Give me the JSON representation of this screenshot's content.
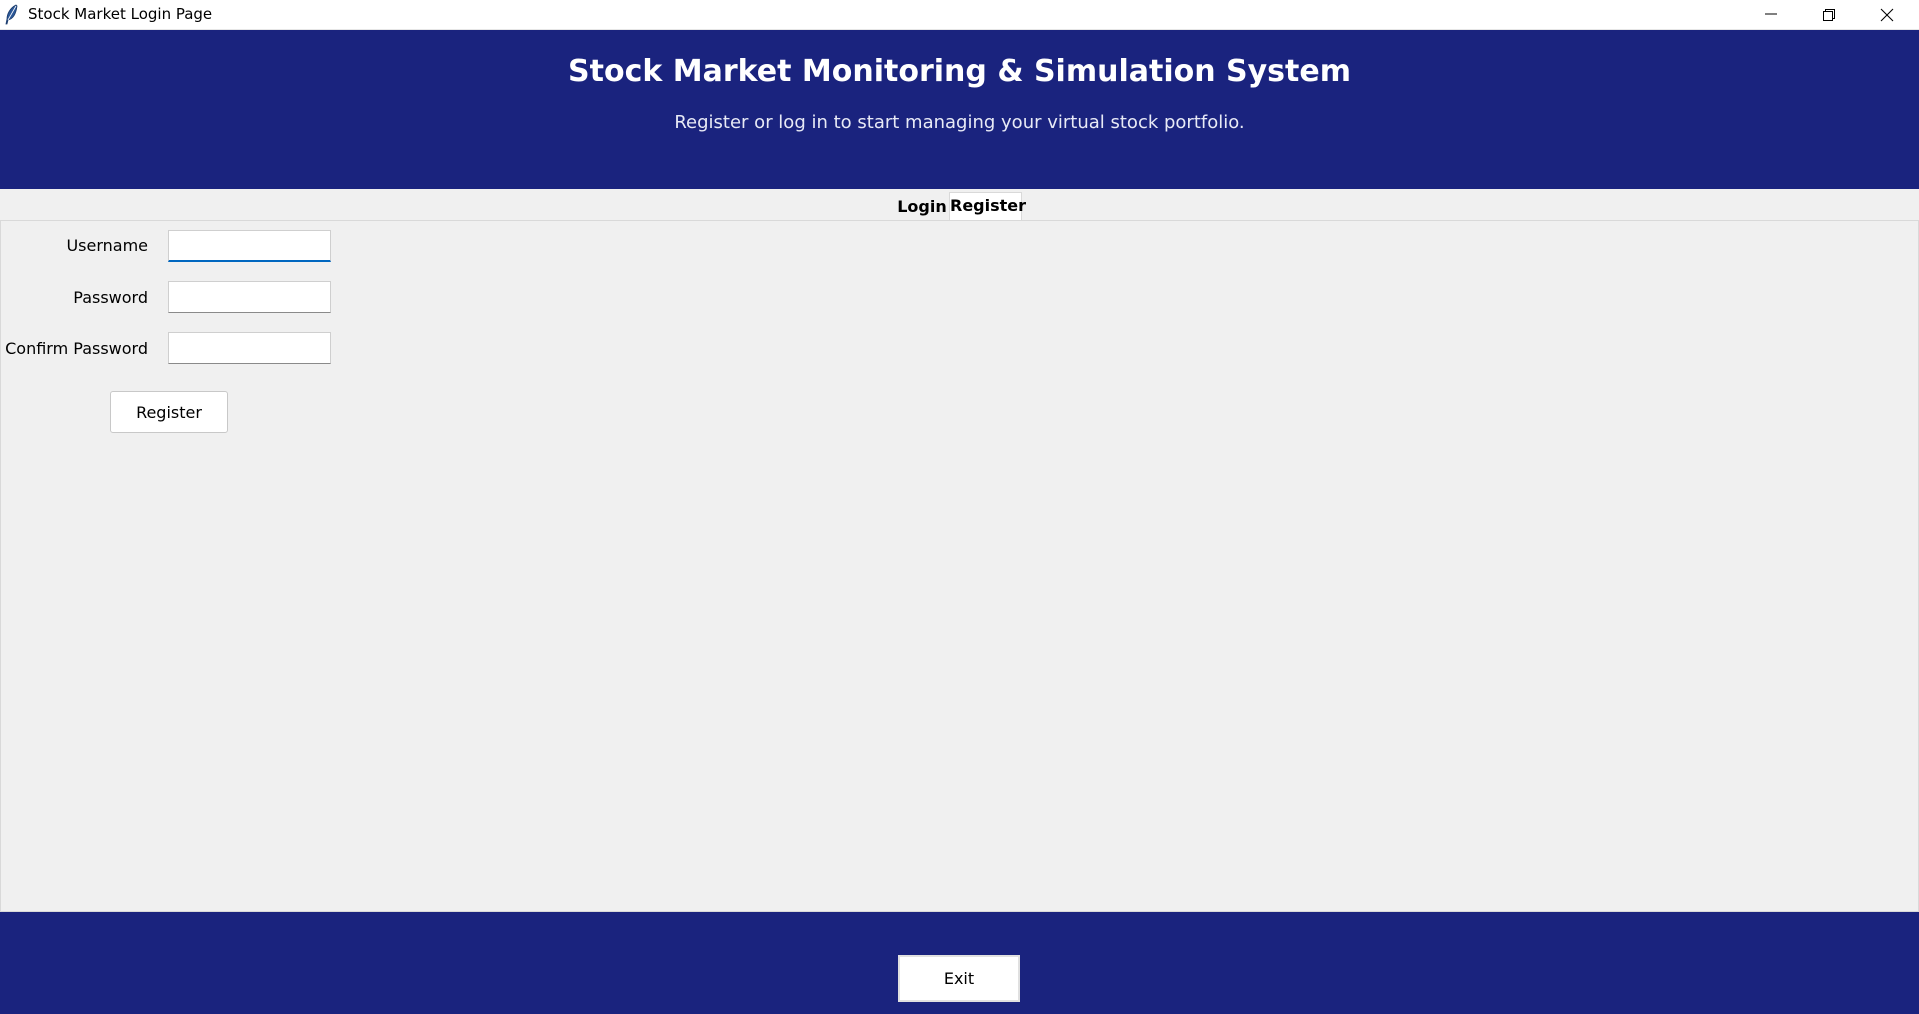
{
  "window": {
    "title": "Stock Market Login Page",
    "app_icon": "feather-icon",
    "controls": [
      "minimize-icon",
      "restore-icon",
      "close-icon"
    ]
  },
  "header": {
    "title": "Stock Market Monitoring & Simulation System",
    "subtitle": "Register or log in to start managing your virtual stock portfolio.",
    "background": "#1a237e"
  },
  "tabs": [
    {
      "label": "Login",
      "selected": false
    },
    {
      "label": "Register",
      "selected": true
    }
  ],
  "register_form": {
    "username_label": "Username",
    "username_value": "",
    "password_label": "Password",
    "password_value": "",
    "confirm_label": "Confirm Password",
    "confirm_value": "",
    "submit_label": "Register"
  },
  "footer": {
    "exit_label": "Exit",
    "background": "#1a237e"
  },
  "colors": {
    "accent": "#0067c0",
    "panel": "#f0f0f0"
  }
}
